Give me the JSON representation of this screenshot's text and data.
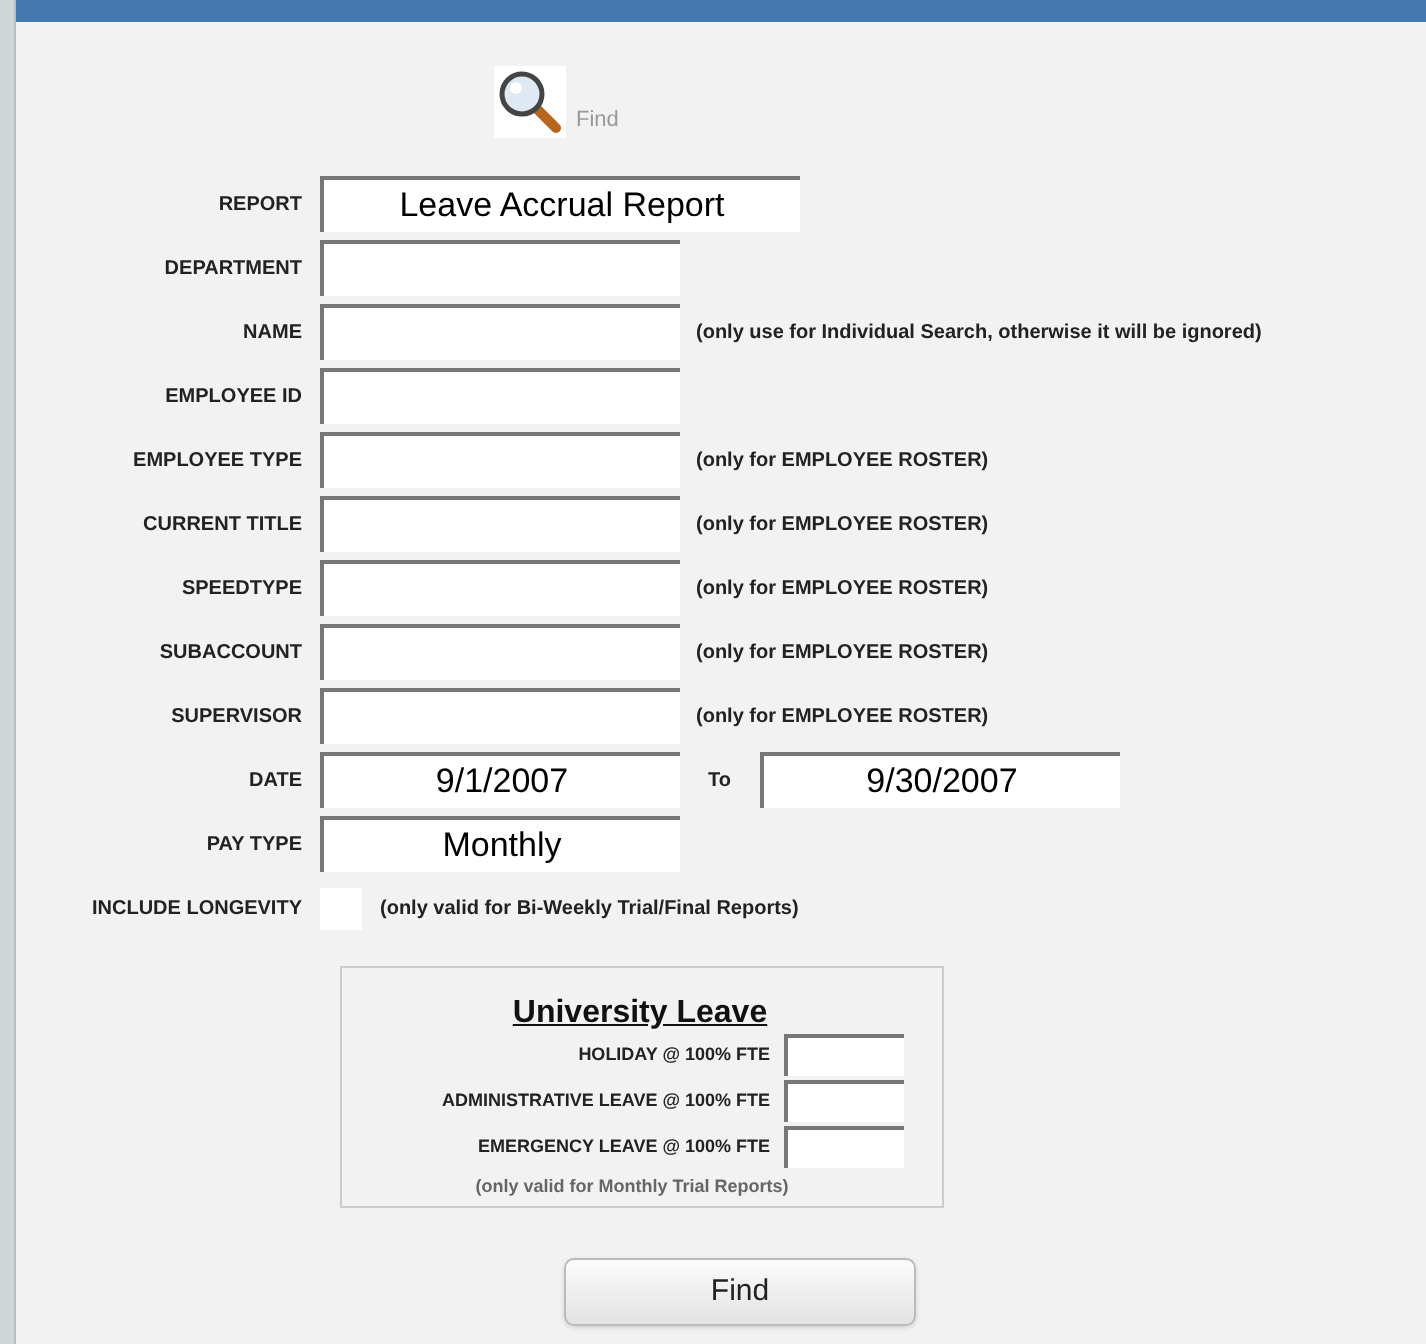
{
  "toolbar": {
    "find_label": "Find"
  },
  "fields": [
    {
      "kind": "text",
      "label": "REPORT",
      "value": "Leave Accrual Report",
      "wide": true
    },
    {
      "kind": "text",
      "label": "DEPARTMENT"
    },
    {
      "kind": "text",
      "label": "NAME",
      "note": "(only use for Individual Search, otherwise it will be ignored)"
    },
    {
      "kind": "text",
      "label": "EMPLOYEE ID"
    },
    {
      "kind": "text",
      "label": "EMPLOYEE TYPE",
      "note": "(only for EMPLOYEE ROSTER)"
    },
    {
      "kind": "text",
      "label": "CURRENT TITLE",
      "note": "(only for EMPLOYEE ROSTER)"
    },
    {
      "kind": "text",
      "label": "SPEEDTYPE",
      "note": "(only for EMPLOYEE ROSTER)"
    },
    {
      "kind": "text",
      "label": "SUBACCOUNT",
      "note": "(only for EMPLOYEE ROSTER)"
    },
    {
      "kind": "text",
      "label": "SUPERVISOR",
      "note": "(only for EMPLOYEE ROSTER)"
    },
    {
      "kind": "range",
      "label": "DATE",
      "value": "9/1/2007",
      "to_label": "To",
      "to_value": "9/30/2007"
    },
    {
      "kind": "text",
      "label": "PAY TYPE",
      "value": "Monthly"
    },
    {
      "kind": "checkbox",
      "label": "INCLUDE LONGEVITY",
      "checked": false,
      "note": "(only valid for Bi-Weekly Trial/Final Reports)"
    }
  ],
  "university_leave": {
    "title": "University Leave",
    "rows": [
      {
        "label": "HOLIDAY @ 100% FTE"
      },
      {
        "label": "ADMINISTRATIVE LEAVE @ 100% FTE"
      },
      {
        "label": "EMERGENCY LEAVE @ 100% FTE"
      }
    ],
    "note": "(only valid for Monthly Trial Reports)"
  },
  "find_button": "Find"
}
